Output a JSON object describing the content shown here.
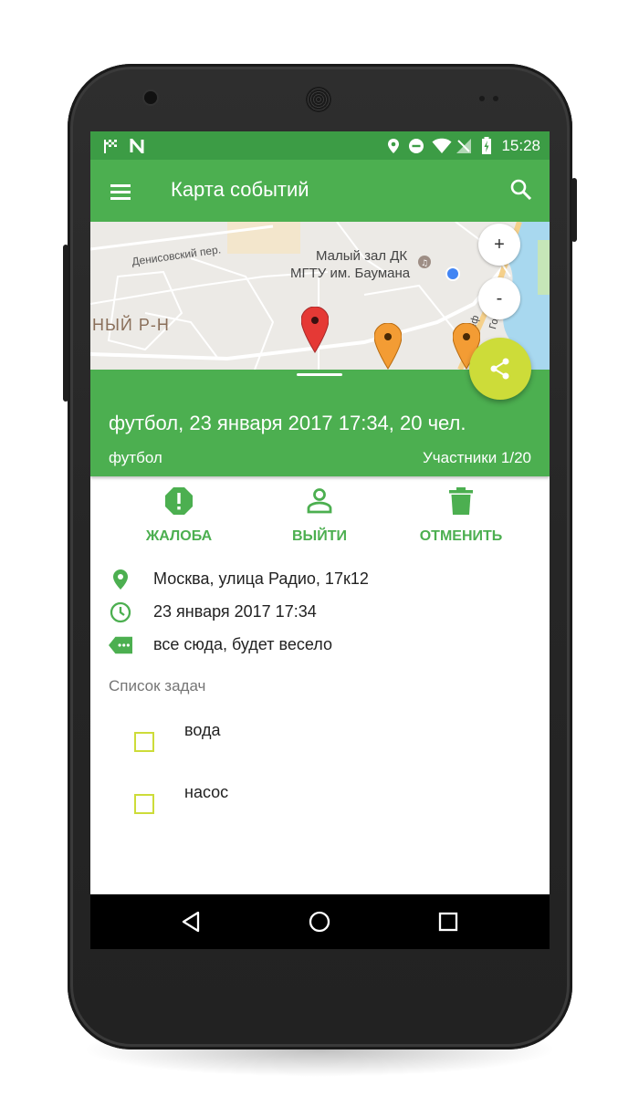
{
  "status_bar": {
    "time": "15:28",
    "icons": [
      "checkered-flag-icon",
      "n-logo-icon",
      "location-icon",
      "do-not-disturb-icon",
      "wifi-icon",
      "no-signal-icon",
      "battery-charging-icon"
    ]
  },
  "app_bar": {
    "title": "Карта событий",
    "menu_icon": "menu-icon",
    "search_icon": "search-icon"
  },
  "map": {
    "streets": [
      "Денисовский пер.",
      "Малый зал ДК",
      "МГТУ им. Баумана",
      "НЫЙ Р-Н",
      "Сеф",
      "Голо"
    ],
    "zoom_in": "+",
    "zoom_out": "-",
    "markers": [
      "red",
      "orange",
      "orange"
    ]
  },
  "event": {
    "title": "футбол, 23 января 2017 17:34, 20 чел.",
    "category": "футбол",
    "participants": "Участники 1/20"
  },
  "actions": [
    {
      "label": "ЖАЛОБА",
      "icon": "report-icon"
    },
    {
      "label": "ВЫЙТИ",
      "icon": "person-icon"
    },
    {
      "label": "ОТМЕНИТЬ",
      "icon": "trash-icon"
    }
  ],
  "details": {
    "address": "Москва, улица Радио, 17к12",
    "datetime": "23 января 2017 17:34",
    "comment": "все сюда, будет весело"
  },
  "tasks": {
    "header": "Список задач",
    "items": [
      {
        "label": "вода",
        "checked": false
      },
      {
        "label": "насос",
        "checked": false
      }
    ]
  },
  "colors": {
    "primary": "#4caf50",
    "primary_dark": "#3c9c45",
    "accent": "#cddc39"
  }
}
